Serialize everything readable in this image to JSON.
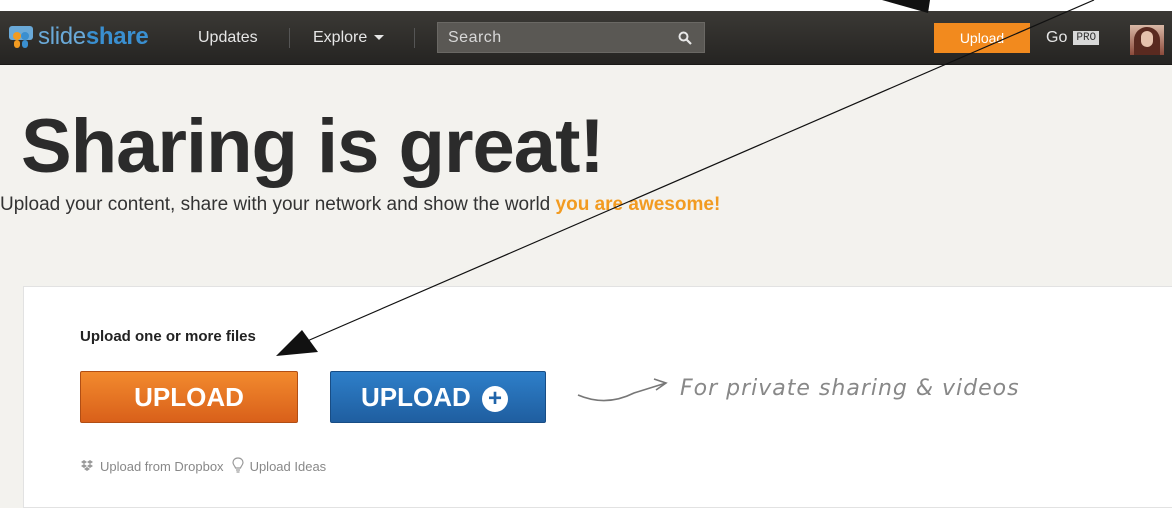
{
  "nav": {
    "logo_slide": "slide",
    "logo_share": "share",
    "updates": "Updates",
    "explore": "Explore",
    "search_placeholder": "Search",
    "upload": "Upload",
    "go": "Go",
    "pro": "PRO"
  },
  "hero": {
    "title": "Sharing is great!",
    "subtitle_prefix": "Upload your content, share with your network and show the world ",
    "subtitle_emphasis": "you are awesome!"
  },
  "uploader": {
    "label": "Upload one or more files",
    "upload_button": "UPLOAD",
    "upload_plus_button": "UPLOAD",
    "plus": "+",
    "private_note": "For private sharing & videos",
    "dropbox_link": "Upload from Dropbox",
    "ideas_link": "Upload Ideas"
  },
  "colors": {
    "accent_orange": "#f28a1e",
    "upload_blue": "#1f64aa",
    "nav_bg": "#2b2a27"
  },
  "icons": [
    "slideshare-logo-icon",
    "chevron-down-icon",
    "search-icon",
    "dropbox-icon",
    "lightbulb-icon",
    "curved-arrow-icon"
  ]
}
